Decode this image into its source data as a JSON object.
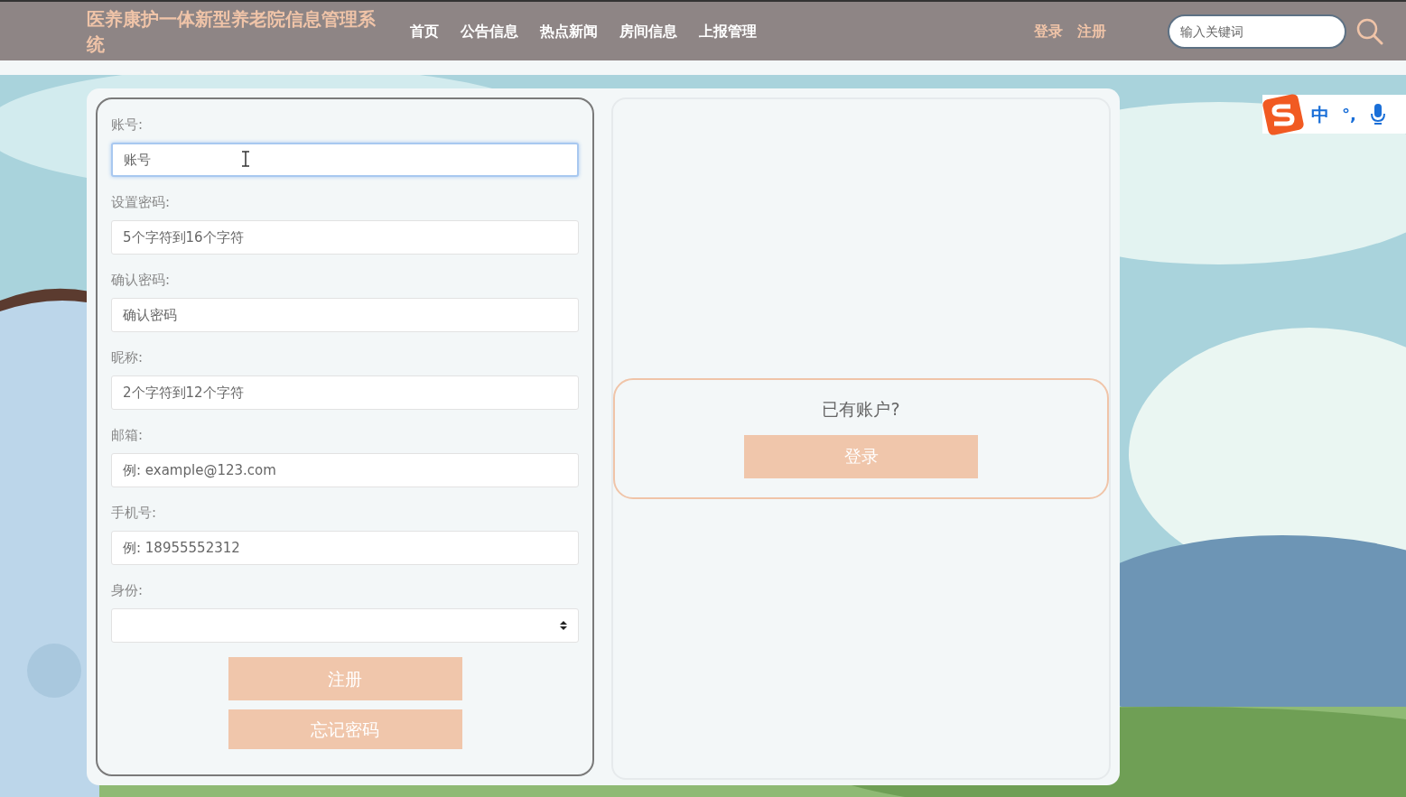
{
  "header": {
    "title": "医养康护一体新型养老院信息管理系统",
    "nav": [
      {
        "label": "首页"
      },
      {
        "label": "公告信息"
      },
      {
        "label": "热点新闻"
      },
      {
        "label": "房间信息"
      },
      {
        "label": "上报管理"
      }
    ],
    "auth_links": [
      {
        "label": "登录"
      },
      {
        "label": "注册"
      }
    ],
    "search": {
      "placeholder": "输入关键词"
    }
  },
  "register_form": {
    "fields": [
      {
        "kind": "text",
        "label": "账号:",
        "placeholder": "账号",
        "focused": true
      },
      {
        "kind": "text",
        "label": "设置密码:",
        "placeholder": "5个字符到16个字符",
        "focused": false
      },
      {
        "kind": "text",
        "label": "确认密码:",
        "placeholder": "确认密码",
        "focused": false
      },
      {
        "kind": "text",
        "label": "昵称:",
        "placeholder": "2个字符到12个字符",
        "focused": false
      },
      {
        "kind": "text",
        "label": "邮箱:",
        "placeholder": "例: example@123.com",
        "focused": false
      },
      {
        "kind": "text",
        "label": "手机号:",
        "placeholder": "例: 18955552312",
        "focused": false
      },
      {
        "kind": "select",
        "label": "身份:",
        "focused": false
      }
    ],
    "buttons": [
      "注册",
      "忘记密码"
    ]
  },
  "login_panel": {
    "prompt": "已有账户?",
    "button": "登录"
  },
  "ime_toolbar": {
    "mode": "中",
    "punctuation": "°,"
  }
}
